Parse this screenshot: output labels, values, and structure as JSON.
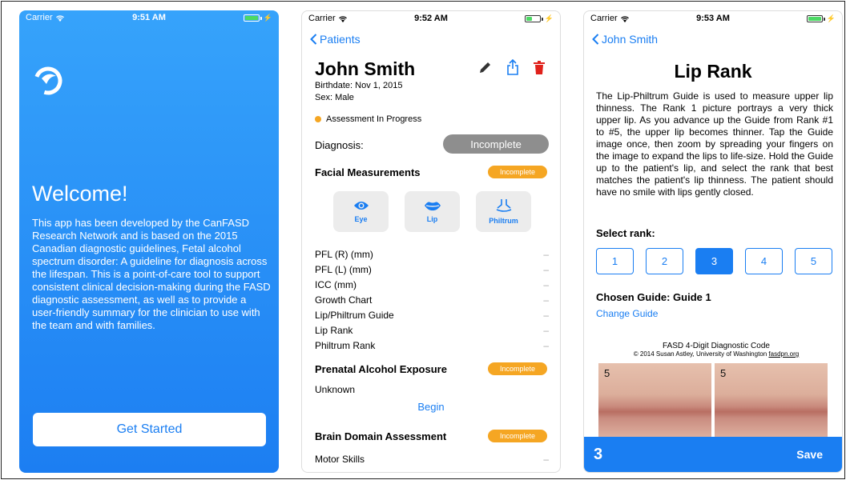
{
  "welcome_screen": {
    "status": {
      "carrier": "Carrier",
      "time": "9:51 AM"
    },
    "title": "Welcome!",
    "body": "This app has been developed by the CanFASD Research Network and is based on the 2015 Canadian diagnostic guidelines, Fetal alcohol spectrum disorder: A guideline for diagnosis across the lifespan.  This is a point-of-care tool to support consistent clinical decision-making during the FASD diagnostic assessment, as well as to provide a user-friendly summary for the clinician to use with the team and with families.",
    "button_label": "Get Started"
  },
  "patient_screen": {
    "status": {
      "carrier": "Carrier",
      "time": "9:52 AM"
    },
    "back_label": "Patients",
    "name": "John Smith",
    "birthdate": "Birthdate: Nov 1, 2015",
    "sex": "Sex: Male",
    "status_text": "Assessment In Progress",
    "diagnosis_label": "Diagnosis:",
    "diagnosis_value": "Incomplete",
    "facial": {
      "title": "Facial Measurements",
      "badge": "Incomplete",
      "tiles": [
        {
          "label": "Eye",
          "icon": "eye-icon"
        },
        {
          "label": "Lip",
          "icon": "lips-icon"
        },
        {
          "label": "Philtrum",
          "icon": "philtrum-icon"
        }
      ],
      "rows": [
        {
          "label": "PFL (R) (mm)",
          "value": "–"
        },
        {
          "label": "PFL (L) (mm)",
          "value": "–"
        },
        {
          "label": "ICC (mm)",
          "value": "–"
        },
        {
          "label": "Growth Chart",
          "value": "–"
        },
        {
          "label": "Lip/Philtrum Guide",
          "value": "–"
        },
        {
          "label": "Lip Rank",
          "value": "–"
        },
        {
          "label": "Philtrum Rank",
          "value": "–"
        }
      ]
    },
    "prenatal": {
      "title": "Prenatal Alcohol Exposure",
      "badge": "Incomplete",
      "value": "Unknown",
      "begin_label": "Begin"
    },
    "brain": {
      "title": "Brain Domain Assessment",
      "badge": "Incomplete",
      "first_row": "Motor Skills",
      "first_value": "–"
    },
    "colors": {
      "accent": "#1a7ef2",
      "badge": "#f5a623",
      "pill": "#8e8e8e"
    }
  },
  "lip_screen": {
    "status": {
      "carrier": "Carrier",
      "time": "9:53 AM"
    },
    "back_label": "John Smith",
    "title": "Lip Rank",
    "body": "The Lip-Philtrum Guide is used to measure upper lip thinness. The Rank 1 picture portrays a very thick upper lip. As you advance up the Guide from Rank #1 to #5, the upper lip becomes thinner. Tap the Guide image once, then zoom by spreading your fingers on the image to expand the lips to life-size. Hold the Guide up to the patient's lip, and select the rank that best matches the patient's lip thinness. The patient should have no smile with lips gently closed.",
    "select_label": "Select rank:",
    "ranks": [
      "1",
      "2",
      "3",
      "4",
      "5"
    ],
    "selected_rank": "3",
    "chosen_guide": "Chosen Guide: Guide 1",
    "change_label": "Change Guide",
    "guide_image": {
      "title": "FASD 4-Digit Diagnostic Code",
      "credit": "© 2014 Susan Astley, University of Washington",
      "link": "fasdpn.org",
      "photo_labels": [
        "5",
        "5"
      ]
    },
    "bottom_value": "3",
    "save_label": "Save"
  }
}
